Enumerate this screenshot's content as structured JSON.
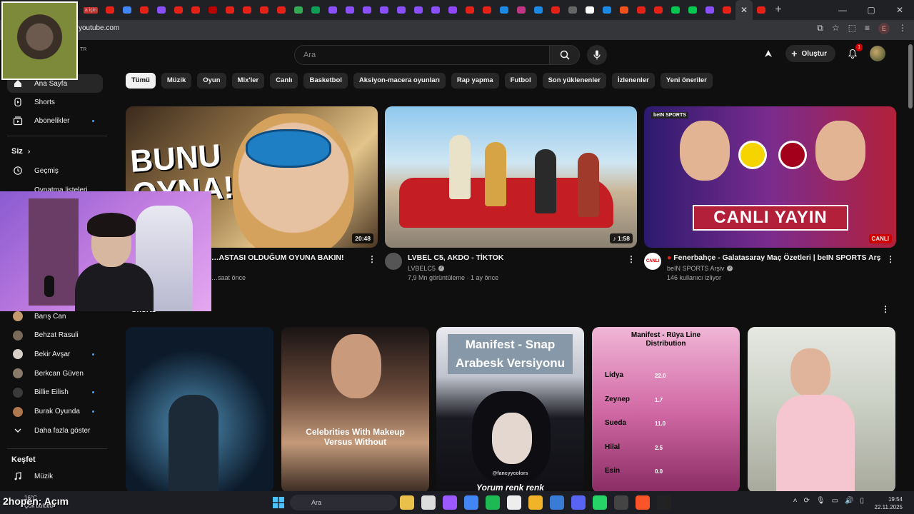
{
  "browser": {
    "url": "youtube.com",
    "tab_partial_label": "a için",
    "new_tab_label": "+",
    "profile_letter": "E",
    "window_controls": [
      "—",
      "▢",
      "✕"
    ]
  },
  "masthead": {
    "country_code": "TR",
    "search_placeholder": "Ara",
    "create_label": "Oluştur",
    "notification_count": "1"
  },
  "sidebar": {
    "main_items": [
      {
        "label": "Ana Sayfa",
        "icon": "home-icon"
      },
      {
        "label": "Shorts",
        "icon": "shorts-icon"
      },
      {
        "label": "Abonelikler",
        "icon": "subscriptions-icon"
      }
    ],
    "you_heading": "Siz",
    "you_items": [
      {
        "label": "Geçmiş",
        "icon": "history-icon"
      },
      {
        "label": "Oynatma listeleri",
        "icon": "playlist-icon"
      }
    ],
    "subscriptions": [
      {
        "label": "Barış Can",
        "color": "#c49a6c",
        "new": false
      },
      {
        "label": "Behzat Rasuli",
        "color": "#7a6a5a",
        "new": false
      },
      {
        "label": "Bekir Avşar",
        "color": "#d8d0c8",
        "new": true
      },
      {
        "label": "Berkcan Güven",
        "color": "#8a7a6a",
        "new": false
      },
      {
        "label": "Billie Eilish",
        "color": "#3a3a3a",
        "new": true
      },
      {
        "label": "Burak Oyunda",
        "color": "#b07850",
        "new": true
      }
    ],
    "show_more": "Daha fazla göster",
    "explore_heading": "Keşfet",
    "explore_items": [
      {
        "label": "Müzik",
        "icon": "music-icon"
      }
    ]
  },
  "chips": [
    "Tümü",
    "Müzik",
    "Oyun",
    "Mix'ler",
    "Canlı",
    "Basketbol",
    "Aksiyon-macera oyunları",
    "Rap yapma",
    "Futbol",
    "Son yüklenenler",
    "İzlenenler",
    "Yeni öneriler"
  ],
  "videos": [
    {
      "title": "…ASTASI OLDUĞUM OYUNA BAKIN!",
      "channel": "",
      "stats": "…saat önce",
      "duration": "20:48",
      "thumb_text_1": "BUNU",
      "thumb_text_2": "OYNA!"
    },
    {
      "title": "LVBEL C5, AKDO - TİKTOK",
      "channel": "LVBELC5",
      "stats": "7,9 Mn görüntüleme · 1 ay önce",
      "duration": "1:58"
    },
    {
      "title": "Fenerbahçe - Galatasaray Maç Özetleri | beIN SPORTS Arşiv",
      "channel": "beIN SPORTS Arşiv",
      "stats": "146 kullanıcı izliyor",
      "live_label": "CANLI",
      "banner": "CANLI YAYIN",
      "brand": "beIN SPORTS",
      "avatar_label": "CANLI"
    }
  ],
  "shorts": {
    "heading": "Shorts",
    "items": [
      {
        "caption": ""
      },
      {
        "caption": "Celebrities With Makeup Versus Without"
      },
      {
        "caption": "Manifest - Snap Arabesk Versiyonu",
        "bottom": "Yorum renk renk",
        "handle": "@fancyycolors"
      },
      {
        "caption": "Manifest - Rüya Line Distribution",
        "rows": [
          {
            "name": "Lidya",
            "value": "22.0"
          },
          {
            "name": "Zeynep",
            "value": "1.7"
          },
          {
            "name": "Sueda",
            "value": "11.0"
          },
          {
            "name": "Hilal",
            "value": "2.5"
          },
          {
            "name": "Esin",
            "value": "0.0"
          }
        ]
      },
      {
        "caption": ""
      }
    ]
  },
  "taskbar": {
    "weather": "16°C",
    "weather_sub": "Çok bulutlu",
    "overlay_text": "2hopen: Açım",
    "search_label": "Ara",
    "time": "19:54",
    "date": "22.11.2025"
  }
}
